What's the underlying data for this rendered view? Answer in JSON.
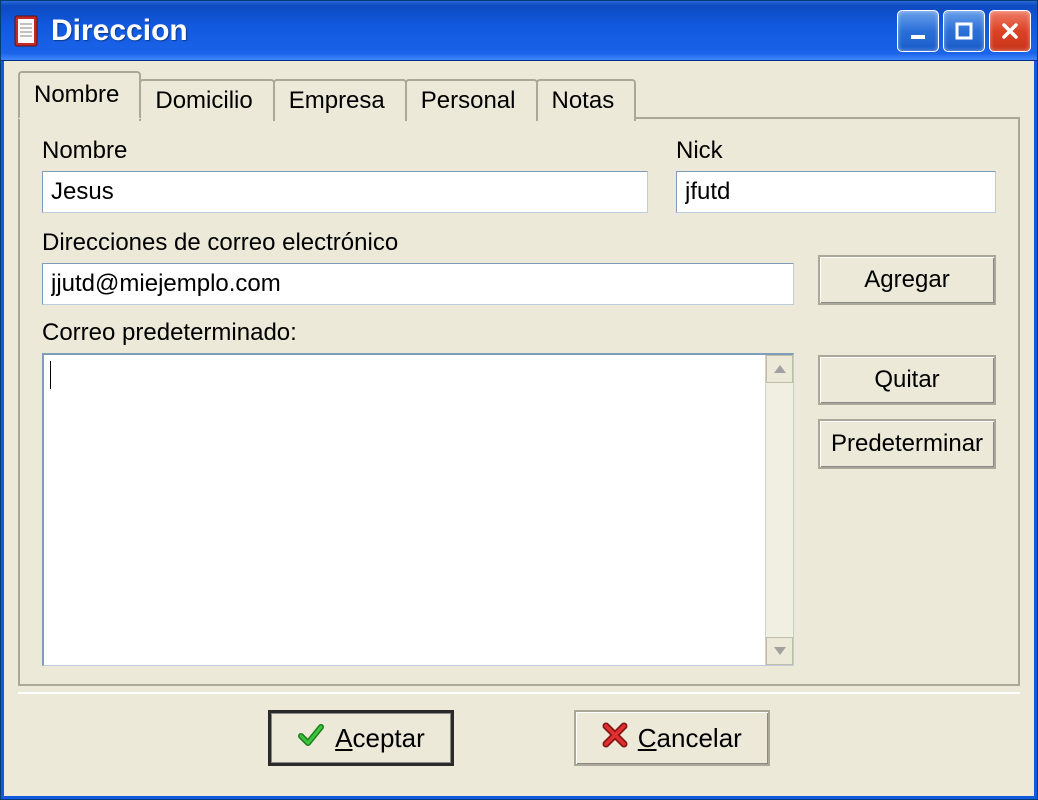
{
  "window": {
    "title": "Direccion"
  },
  "tabs": {
    "t0": "Nombre",
    "t1": "Domicilio",
    "t2": "Empresa",
    "t3": "Personal",
    "t4": "Notas"
  },
  "form": {
    "name_label": "Nombre",
    "name_value": "Jesus",
    "nick_label": "Nick",
    "nick_value": "jfutd",
    "email_label": "Direcciones de correo electrónico",
    "email_value": "jjutd@miejemplo.com",
    "default_mail_label": "Correo predeterminado:"
  },
  "buttons": {
    "add": "Agregar",
    "remove": "Quitar",
    "set_default": "Predeterminar",
    "accept_prefix": "A",
    "accept_rest": "ceptar",
    "cancel_prefix": "C",
    "cancel_rest": "ancelar"
  }
}
